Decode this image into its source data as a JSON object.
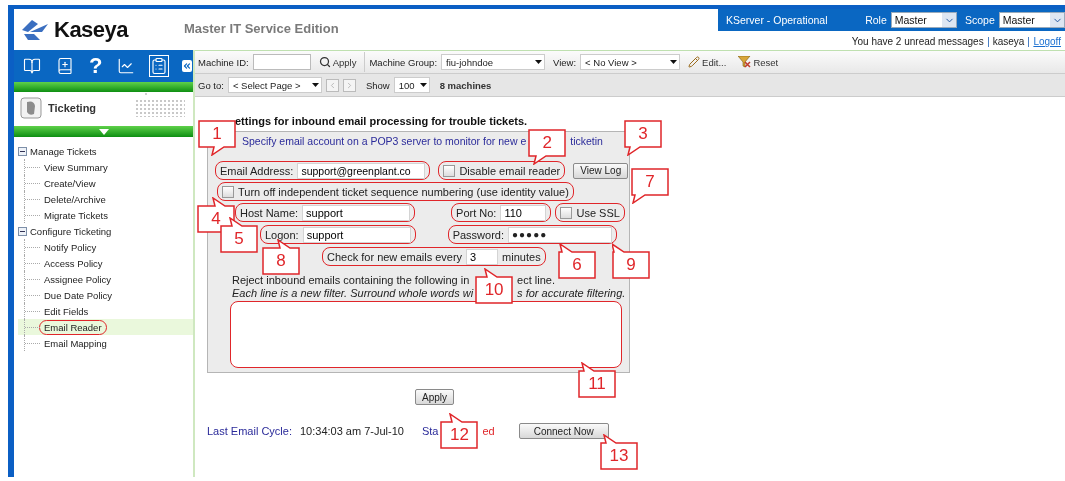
{
  "header": {
    "logo": "Kaseya",
    "edition": "Master IT Service Edition",
    "server_status": "KServer - Operational",
    "role_label": "Role",
    "role_value": "Master",
    "scope_label": "Scope",
    "scope_value": "Master",
    "messages": "You have 2 unread messages",
    "user": "kaseya",
    "logoff": "Logoff"
  },
  "sidebar": {
    "toolbar": [
      {
        "kind": "book",
        "selected": false
      },
      {
        "kind": "book-add",
        "selected": false
      },
      {
        "kind": "help",
        "label": "?",
        "selected": false
      },
      {
        "kind": "chart",
        "selected": false
      },
      {
        "kind": "clipboard",
        "selected": true
      },
      {
        "kind": "collapse",
        "selected": false
      }
    ],
    "module": "Ticketing",
    "tree": [
      {
        "label": "Manage Tickets",
        "expanded": true,
        "children": [
          {
            "label": "View Summary",
            "selected": false
          },
          {
            "label": "Create/View",
            "selected": false
          },
          {
            "label": "Delete/Archive",
            "selected": false
          },
          {
            "label": "Migrate Tickets",
            "selected": false
          }
        ]
      },
      {
        "label": "Configure Ticketing",
        "expanded": true,
        "children": [
          {
            "label": "Notify Policy",
            "selected": false
          },
          {
            "label": "Access Policy",
            "selected": false
          },
          {
            "label": "Assignee Policy",
            "selected": false
          },
          {
            "label": "Due Date Policy",
            "selected": false
          },
          {
            "label": "Edit Fields",
            "selected": false
          },
          {
            "label": "Email Reader",
            "selected": true
          },
          {
            "label": "Email Mapping",
            "selected": false
          }
        ]
      }
    ]
  },
  "toolbar": {
    "machine_id_label": "Machine ID:",
    "apply": "Apply",
    "machine_group_label": "Machine Group:",
    "machine_group": "fiu-johndoe",
    "view_label": "View:",
    "view": "< No View >",
    "edit": "Edit...",
    "reset": "Reset",
    "goto_label": "Go to:",
    "goto": "< Select Page >",
    "show_label": "Show",
    "show": "100",
    "count": "8 machines"
  },
  "form": {
    "heading": "ettings for inbound email processing for trouble tickets.",
    "intro": [
      "Specify email account on a POP3 server to monitor for new e",
      "ticketin"
    ],
    "email_label": "Email Address:",
    "email": "support@greenplant.co",
    "disable_reader": {
      "label": "Disable email reader",
      "checked": false
    },
    "view_log": "View Log",
    "turn_off": {
      "label": "Turn off independent ticket sequence numbering (use identity value)",
      "checked": false
    },
    "host_label": "Host Name:",
    "host": "support",
    "port_label": "Port No:",
    "port": "110",
    "ssl": {
      "label": "Use SSL",
      "checked": false
    },
    "logon_label": "Logon:",
    "logon": "support",
    "password_label": "Password:",
    "password": "●●●●●",
    "check_label": "Check for new emails every",
    "check_value": "3",
    "check_unit": "minutes",
    "reject": [
      "Reject inbound emails containing the following in",
      "ect line."
    ],
    "hint": [
      "Each line is a new filter. Surround whole words wi",
      "s for accurate filtering."
    ],
    "apply": "Apply",
    "last_cycle_label": "Last Email Cycle:",
    "last_cycle": "10:34:03 am 7-Jul-10",
    "status": [
      "Sta",
      "ed"
    ],
    "connect": "Connect Now"
  },
  "callouts": [
    {
      "number": "1"
    },
    {
      "number": "2"
    },
    {
      "number": "3"
    },
    {
      "number": "4"
    },
    {
      "number": "5"
    },
    {
      "number": "6"
    },
    {
      "number": "7"
    },
    {
      "number": "8"
    },
    {
      "number": "9"
    },
    {
      "number": "10"
    },
    {
      "number": "11"
    },
    {
      "number": "12"
    },
    {
      "number": "13"
    }
  ]
}
